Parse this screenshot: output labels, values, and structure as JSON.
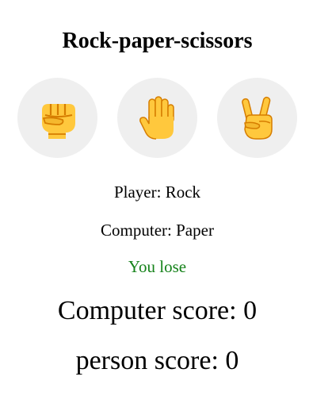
{
  "title": "Rock-paper-scissors",
  "choices": [
    {
      "id": "rock",
      "icon": "raised-fist-icon"
    },
    {
      "id": "paper",
      "icon": "raised-hand-icon"
    },
    {
      "id": "scissors",
      "icon": "victory-hand-icon"
    }
  ],
  "status": {
    "player": "Player: Rock",
    "computer": "Computer: Paper",
    "result": "You lose"
  },
  "scores": {
    "computer": "Computer score: 0",
    "person": "person score: 0"
  },
  "colors": {
    "result": "#15821a",
    "button_bg": "#efefef",
    "emoji_skin": "#ffc83d",
    "emoji_shade": "#d67d00"
  }
}
